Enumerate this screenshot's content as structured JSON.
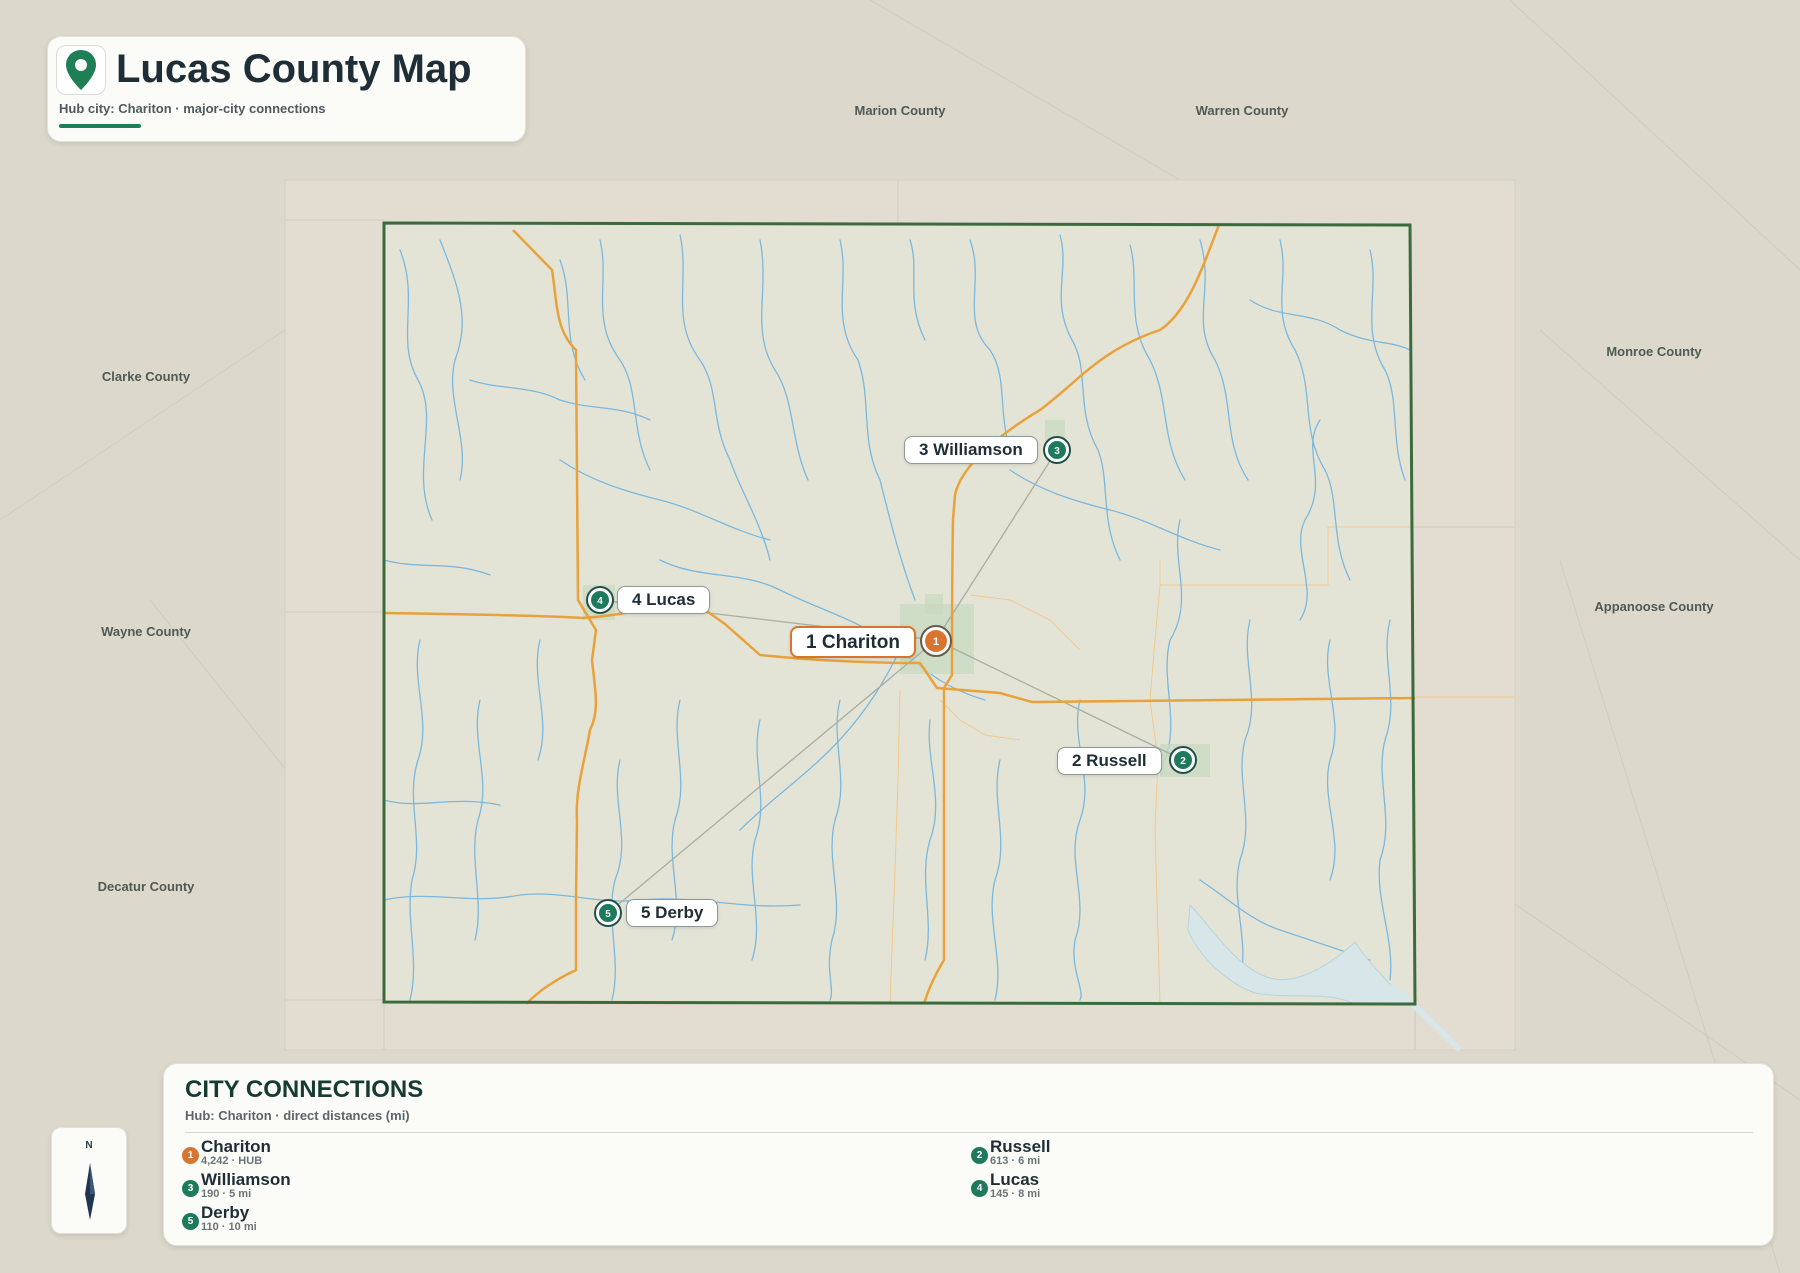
{
  "title": "Lucas County Map",
  "subtitle": "Hub city: Chariton · major-city connections",
  "neighbor_counties": [
    "Marion County",
    "Warren County",
    "Clarke County",
    "Monroe County",
    "Wayne County",
    "Appanoose County",
    "Decatur County"
  ],
  "map_labels": {
    "chariton": "1 Chariton",
    "williamson": "3 Williamson",
    "lucas": "4 Lucas",
    "russell": "2 Russell",
    "derby": "5 Derby"
  },
  "markers": {
    "chariton": "1",
    "russell": "2",
    "williamson": "3",
    "lucas": "4",
    "derby": "5"
  },
  "compass_label": "N",
  "legend": {
    "title": "CITY CONNECTIONS",
    "subtitle": "Hub: Chariton · direct distances (mi)",
    "items": [
      {
        "num": "1",
        "name": "Chariton",
        "detail": "4,242 · HUB",
        "color": "#d9742f"
      },
      {
        "num": "2",
        "name": "Russell",
        "detail": "613 · 6 mi",
        "color": "#1e7a5c"
      },
      {
        "num": "3",
        "name": "Williamson",
        "detail": "190 · 5 mi",
        "color": "#1e7a5c"
      },
      {
        "num": "4",
        "name": "Lucas",
        "detail": "145 · 8 mi",
        "color": "#1e7a5c"
      },
      {
        "num": "5",
        "name": "Derby",
        "detail": "110 · 10 mi",
        "color": "#1e7a5c"
      }
    ]
  },
  "colors": {
    "hub": "#d9742f",
    "city": "#1e7a5c",
    "boundary": "#3b6b3d",
    "road": "#e9a23b",
    "water": "#7ab8de",
    "background": "#dcd8cb"
  },
  "icons": [
    "map-pin-icon",
    "compass-needle-icon"
  ]
}
